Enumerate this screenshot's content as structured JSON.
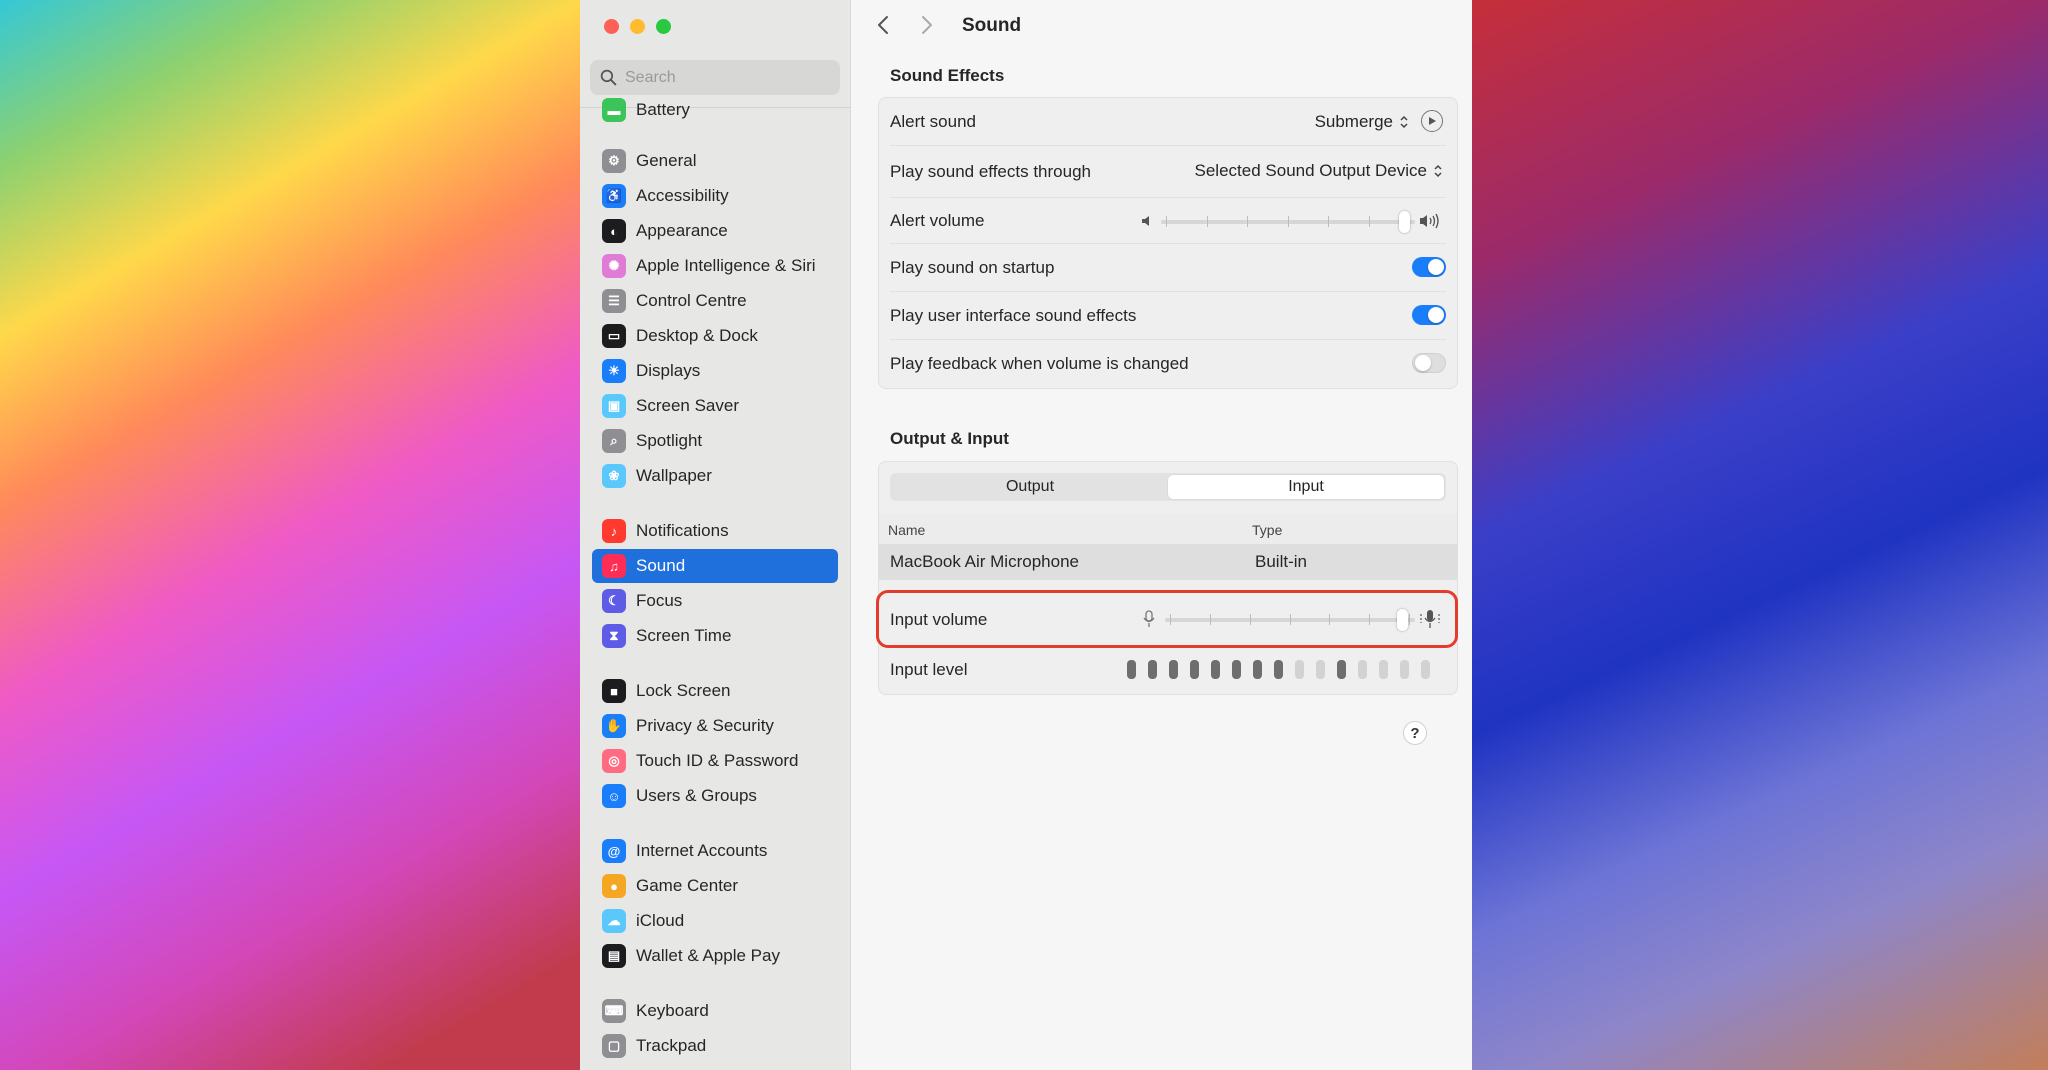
{
  "search": {
    "placeholder": "Search"
  },
  "sidebar": {
    "items": [
      {
        "label": "Battery",
        "icon": "battery-icon",
        "color": "#3ac45a"
      },
      {
        "label": "General",
        "icon": "gear-icon",
        "color": "#8e8e93"
      },
      {
        "label": "Accessibility",
        "icon": "accessibility-icon",
        "color": "#1a7dfa"
      },
      {
        "label": "Appearance",
        "icon": "appearance-icon",
        "color": "#1c1c1e"
      },
      {
        "label": "Apple Intelligence & Siri",
        "icon": "siri-icon",
        "color": "#e07bd6"
      },
      {
        "label": "Control Centre",
        "icon": "control-centre-icon",
        "color": "#8e8e93"
      },
      {
        "label": "Desktop & Dock",
        "icon": "dock-icon",
        "color": "#1c1c1e"
      },
      {
        "label": "Displays",
        "icon": "sun-icon",
        "color": "#1a7dfa"
      },
      {
        "label": "Screen Saver",
        "icon": "screen-saver-icon",
        "color": "#5ac8fa"
      },
      {
        "label": "Spotlight",
        "icon": "magnifier-icon",
        "color": "#8e8e93"
      },
      {
        "label": "Wallpaper",
        "icon": "flower-icon",
        "color": "#5ac8fa"
      },
      {
        "label": "Notifications",
        "icon": "bell-icon",
        "color": "#ff3b30"
      },
      {
        "label": "Sound",
        "icon": "speaker-icon",
        "color": "#ff2d55"
      },
      {
        "label": "Focus",
        "icon": "moon-icon",
        "color": "#5e5ce6"
      },
      {
        "label": "Screen Time",
        "icon": "hourglass-icon",
        "color": "#5e5ce6"
      },
      {
        "label": "Lock Screen",
        "icon": "lock-icon",
        "color": "#1c1c1e"
      },
      {
        "label": "Privacy & Security",
        "icon": "hand-icon",
        "color": "#1a7dfa"
      },
      {
        "label": "Touch ID & Password",
        "icon": "fingerprint-icon",
        "color": "#ff6b81"
      },
      {
        "label": "Users & Groups",
        "icon": "users-icon",
        "color": "#1a7dfa"
      },
      {
        "label": "Internet Accounts",
        "icon": "at-icon",
        "color": "#1a7dfa"
      },
      {
        "label": "Game Center",
        "icon": "game-center-icon",
        "color": "#f5a623"
      },
      {
        "label": "iCloud",
        "icon": "cloud-icon",
        "color": "#5ac8fa"
      },
      {
        "label": "Wallet & Apple Pay",
        "icon": "wallet-icon",
        "color": "#1c1c1e"
      },
      {
        "label": "Keyboard",
        "icon": "keyboard-icon",
        "color": "#8e8e93"
      },
      {
        "label": "Trackpad",
        "icon": "trackpad-icon",
        "color": "#8e8e93"
      }
    ],
    "active": "Sound"
  },
  "header": {
    "title": "Sound"
  },
  "sound_effects": {
    "title": "Sound Effects",
    "alert_sound_label": "Alert sound",
    "alert_sound_value": "Submerge",
    "play_through_label": "Play sound effects through",
    "play_through_value": "Selected Sound Output Device",
    "alert_volume_label": "Alert volume",
    "alert_volume_level": 0.98,
    "startup_label": "Play sound on startup",
    "startup_on": true,
    "ui_sounds_label": "Play user interface sound effects",
    "ui_sounds_on": true,
    "feedback_label": "Play feedback when volume is changed",
    "feedback_on": false
  },
  "output_input": {
    "title": "Output & Input",
    "tabs": [
      "Output",
      "Input"
    ],
    "selected_tab": "Input",
    "columns": [
      "Name",
      "Type"
    ],
    "devices": [
      {
        "name": "MacBook Air Microphone",
        "type": "Built-in"
      }
    ],
    "input_volume_label": "Input volume",
    "input_volume_level": 0.97,
    "input_level_label": "Input level",
    "input_level_bars": [
      1,
      1,
      1,
      1,
      1,
      1,
      1,
      1,
      0,
      0,
      1,
      0,
      0,
      0,
      0
    ]
  },
  "help": {
    "label": "?"
  }
}
